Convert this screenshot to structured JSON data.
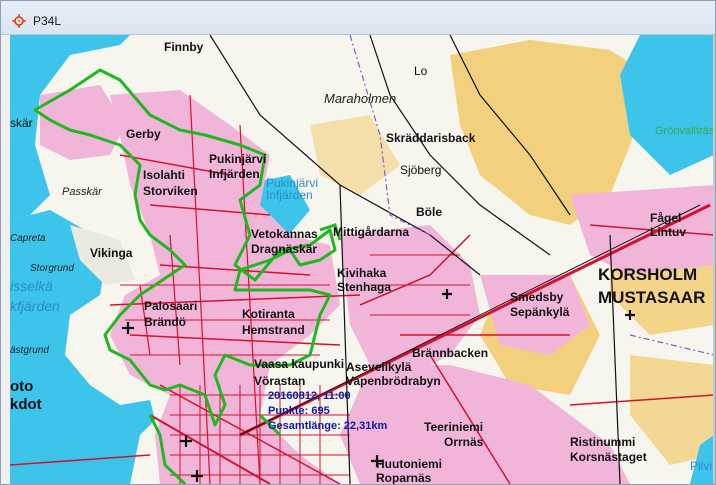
{
  "window": {
    "title": "P34L",
    "icon": "crosshair-icon"
  },
  "colors": {
    "water": "#3dc4ea",
    "urban": "#f2b5da",
    "roads": "#d2132e",
    "fields": "#f3d07d",
    "track": "#20b820",
    "info_text": "#0a1aa8"
  },
  "map_labels": {
    "finnby": "Finnby",
    "gerby": "Gerby",
    "passkaret": "Passkär",
    "skar": "skär",
    "isolahti": "Isolahti",
    "storviken": "Storviken",
    "pukinjarvi": "Pukinjärvi",
    "infjarden": "Infjärden",
    "pukinjarvi_water": "Pukinjärvi",
    "infjarden_water": "Infjärden",
    "maraholmen": "Maraholmen",
    "skraddarisback": "Skräddarisback",
    "sjoberg": "Sjöberg",
    "lo": "Lo",
    "gronvalltras": "Grönvallträs",
    "capreta": "Capreta",
    "vikinga": "Vikinga",
    "storgrund": "Storgrund",
    "isselka": "isselkä",
    "kfjarden": "kfjärden",
    "vetokannas": "Vetokannas",
    "dragnaskar": "Dragnäskär",
    "mittigardarna": "Mittigårdarna",
    "bole": "Böle",
    "fagel": "Fågel",
    "lintuv": "Lintuv",
    "korsholm": "KORSHOLM",
    "mustasaari": "MUSTASAAR",
    "palosaari": "Palosaari",
    "brando": "Brändö",
    "kivihaka": "Kivihaka",
    "stenhaga": "Stenhaga",
    "smedsby": "Smedsby",
    "sepankyla": "Sepänkylä",
    "astgrund": "ästgrund",
    "kotiranta": "Kotiranta",
    "hemstrand": "Hemstrand",
    "brannbacken": "Brännbacken",
    "oto": "oto",
    "kdot": "kdot",
    "vaasa_city": "Vaasa kaupunki",
    "vorastan": "Vörastan",
    "asevelikyla": "Asevelikylä",
    "vapenbrodrabyn": "Vapenbrödrabyn",
    "teeriniemi": "Teeriniemi",
    "ormas": "Orrnäs",
    "ristinummi": "Ristinummi",
    "korsnastaget": "Korsnästaget",
    "huutoniemi": "Huutoniemi",
    "roparnas": "Roparnäs",
    "pilvi": "Pilvi"
  },
  "track_info": {
    "timestamp": "20160812, 11:00",
    "points": "Punkte: 695",
    "length": "Gesamtlänge: 22,31km"
  }
}
